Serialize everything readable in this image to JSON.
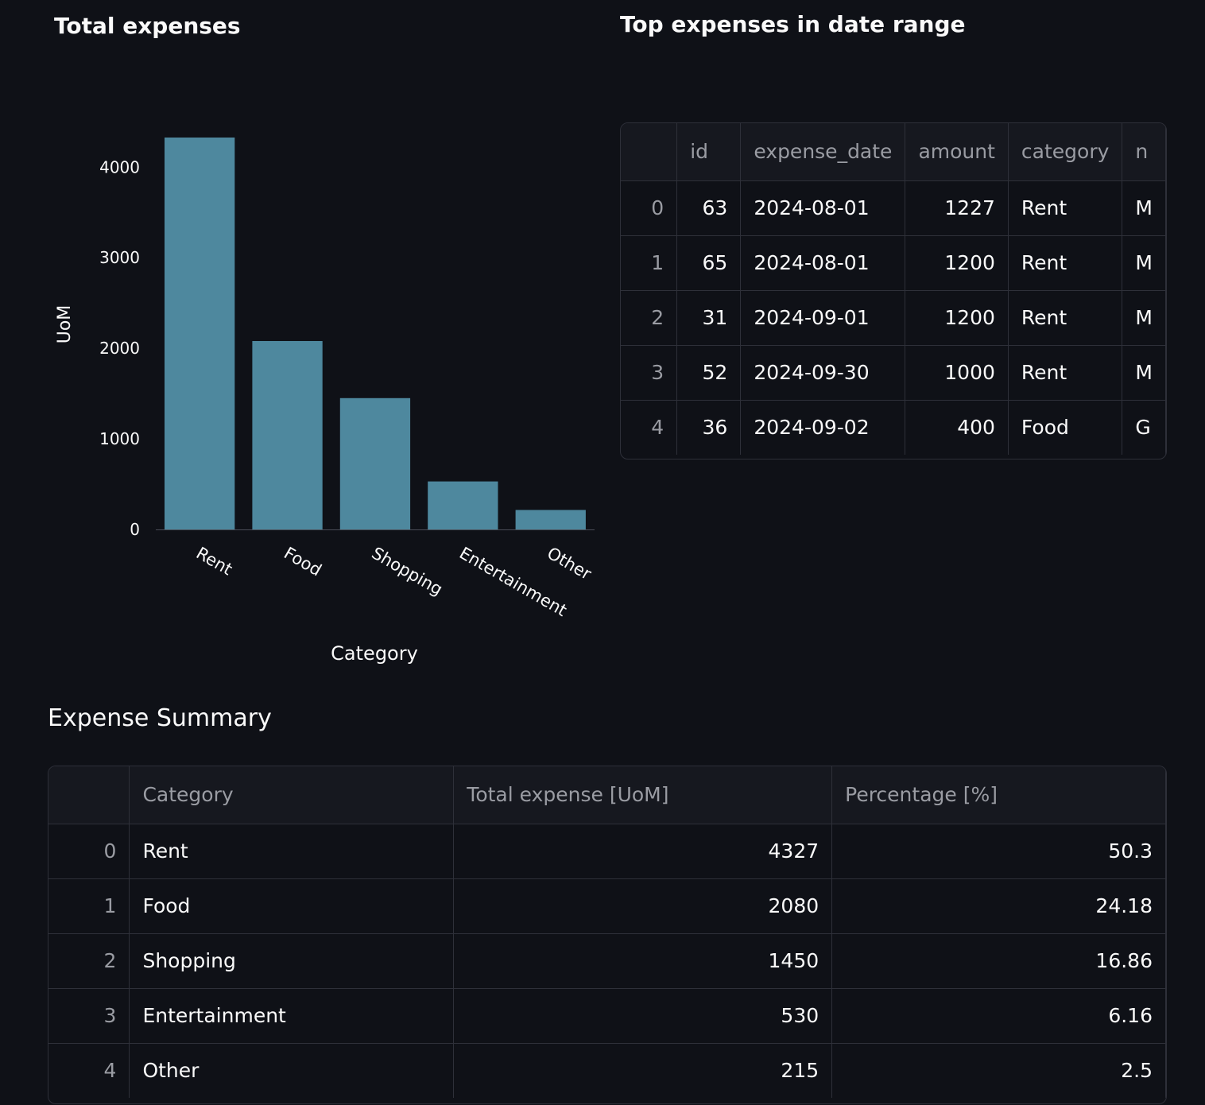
{
  "chart_section": {
    "title": "Total expenses"
  },
  "top_section": {
    "title": "Top expenses in date range"
  },
  "summary_section": {
    "title": "Expense Summary"
  },
  "colors": {
    "bar": "#4e889e",
    "background": "#0f1117",
    "text": "#fafafa",
    "muted": "#9a9ca3",
    "border": "#2e3039"
  },
  "chart_data": {
    "type": "bar",
    "categories": [
      "Rent",
      "Food",
      "Shopping",
      "Entertainment",
      "Other"
    ],
    "values": [
      4327,
      2080,
      1450,
      530,
      215
    ],
    "xlabel": "Category",
    "ylabel": "UoM",
    "yticks": [
      "0",
      "1000",
      "2000",
      "3000",
      "4000"
    ],
    "ylim": [
      0,
      4327
    ],
    "grid": false
  },
  "top_table": {
    "columns": [
      "",
      "id",
      "expense_date",
      "amount",
      "category",
      "n"
    ],
    "rows": [
      [
        "0",
        "63",
        "2024-08-01",
        "1227",
        "Rent",
        "M"
      ],
      [
        "1",
        "65",
        "2024-08-01",
        "1200",
        "Rent",
        "M"
      ],
      [
        "2",
        "31",
        "2024-09-01",
        "1200",
        "Rent",
        "M"
      ],
      [
        "3",
        "52",
        "2024-09-30",
        "1000",
        "Rent",
        "M"
      ],
      [
        "4",
        "36",
        "2024-09-02",
        "400",
        "Food",
        "G"
      ]
    ]
  },
  "summary_table": {
    "columns": [
      "",
      "Category",
      "Total expense [UoM]",
      "Percentage [%]"
    ],
    "rows": [
      [
        "0",
        "Rent",
        "4327",
        "50.3"
      ],
      [
        "1",
        "Food",
        "2080",
        "24.18"
      ],
      [
        "2",
        "Shopping",
        "1450",
        "16.86"
      ],
      [
        "3",
        "Entertainment",
        "530",
        "6.16"
      ],
      [
        "4",
        "Other",
        "215",
        "2.5"
      ]
    ]
  }
}
